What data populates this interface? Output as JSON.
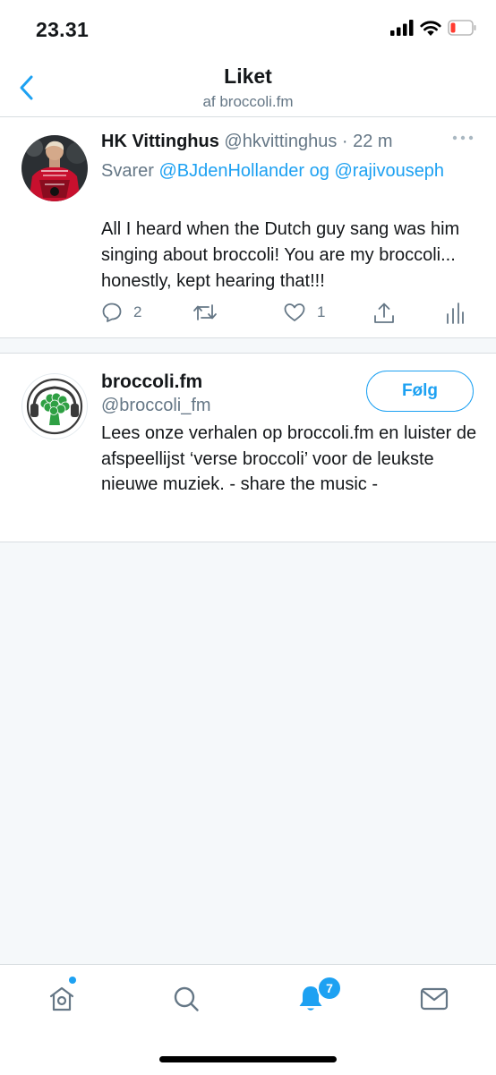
{
  "status_bar": {
    "time": "23.31",
    "icons": [
      "cellular-signal-icon",
      "wifi-icon",
      "battery-low-icon"
    ],
    "battery_color": "#ff3b30"
  },
  "nav": {
    "title": "Liket",
    "subtitle": "af broccoli.fm",
    "back_icon": "chevron-left-icon"
  },
  "tweet": {
    "author_name": "HK Vittinghus",
    "author_handle": "@hkvittinghus",
    "time": "· 22 m",
    "reply_prefix": "Svarer",
    "reply_to_1": "@BJdenHollander",
    "reply_joiner": "og",
    "reply_to_2": "@rajivouseph",
    "text": "All I heard when the Dutch guy sang was him singing about broccoli! You are my broccoli... honestly, kept hearing that!!!",
    "replies": "2",
    "retweets": "",
    "likes": "1",
    "avatar_jersey_text": [
      "VITTINGHUS",
      "DENMARK",
      "FFORZA"
    ]
  },
  "user": {
    "name": "broccoli.fm",
    "handle": "@broccoli_fm",
    "follow_label": "Følg",
    "bio": "Lees onze verhalen op broccoli.fm en luister de afspeellijst ‘verse broccoli’ voor de leukste nieuwe muziek. - share the music -"
  },
  "tabbar": {
    "tabs": [
      "home-icon",
      "search-icon",
      "notifications-icon",
      "messages-icon"
    ],
    "notifications_badge": "7",
    "accent": "#1da1f2"
  }
}
